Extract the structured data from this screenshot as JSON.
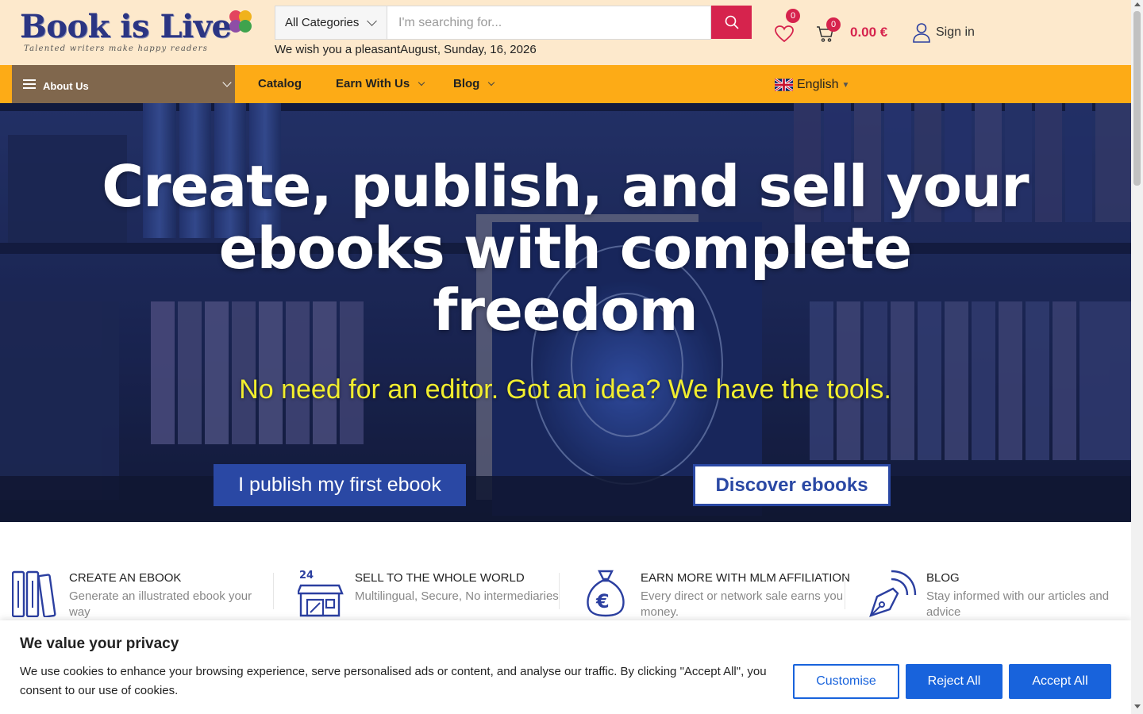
{
  "header": {
    "logo_text": "Book is Live",
    "logo_tagline": "Talented writers make happy readers",
    "category_select": "All Categories",
    "search_placeholder": "I'm searching for...",
    "greeting": "We wish you a pleasantAugust, Sunday, 16, 2026",
    "wishlist_count": "0",
    "cart_count": "0",
    "cart_total": "0.00 €",
    "signin_label": "Sign in",
    "colors": {
      "header_bg": "#fde9cc",
      "accent": "#d6234d",
      "brand": "#2b3583"
    }
  },
  "nav": {
    "about_label": "About Us",
    "items": [
      {
        "label": "Catalog"
      },
      {
        "label": "Earn With Us"
      },
      {
        "label": "Blog"
      }
    ],
    "language": "English",
    "colors": {
      "nav_bg": "#fdab16",
      "about_bg": "#80674d"
    }
  },
  "hero": {
    "title": "Create, publish, and sell your ebooks with complete freedom",
    "subtitle": "No need for an editor. Got an idea? We have the tools.",
    "primary_button": "I publish my first ebook",
    "secondary_button": "Discover ebooks",
    "colors": {
      "subtitle": "#f2ee2e",
      "button": "#2a48a4"
    }
  },
  "features": [
    {
      "icon": "books-icon",
      "title": "CREATE AN EBOOK",
      "desc": "Generate an illustrated ebook your way"
    },
    {
      "icon": "store-24-icon",
      "title": "SELL TO THE WHOLE WORLD",
      "desc": "Multilingual, Secure, No intermediaries"
    },
    {
      "icon": "money-bag-euro-icon",
      "title": "EARN MORE WITH MLM AFFILIATION",
      "desc": "Every direct or network sale earns you money."
    },
    {
      "icon": "pen-broadcast-icon",
      "title": "BLOG",
      "desc": "Stay informed with our articles and advice"
    }
  ],
  "cookie": {
    "title": "We value your privacy",
    "text": "We use cookies to enhance your browsing experience, serve personalised ads or content, and analyse our traffic. By clicking \"Accept All\", you consent to our use of cookies.",
    "customise": "Customise",
    "reject": "Reject All",
    "accept": "Accept All",
    "colors": {
      "button": "#1863dc"
    }
  }
}
